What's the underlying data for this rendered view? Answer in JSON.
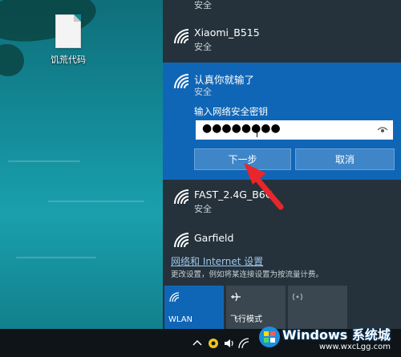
{
  "desktop": {
    "icon_label": "饥荒代码"
  },
  "top_item_status": "安全",
  "networks": [
    {
      "ssid": "Xiaomi_B515",
      "status": "安全"
    },
    {
      "ssid": "FAST_2.4G_B6",
      "ssid_suffix": "C",
      "status": "安全"
    },
    {
      "ssid": "Garfield"
    }
  ],
  "active": {
    "ssid": "认真你就输了",
    "status": "安全",
    "prompt": "输入网络安全密钥",
    "password_mask": "●●●●●●●●",
    "next_button": "下一步",
    "cancel_button": "取消"
  },
  "settings": {
    "link": "网络和 Internet 设置",
    "description": "更改设置，例如将某连接设置为按流量计费。"
  },
  "tiles": [
    {
      "label": "WLAN",
      "active": true
    },
    {
      "label": "飞行模式",
      "active": false
    },
    {
      "label": "",
      "active": false
    }
  ],
  "watermark": {
    "title": "Windows 系统城",
    "url": "www.wxcLgg.com"
  },
  "colors": {
    "accent": "#1066b6",
    "flyout": "#25323b",
    "button": "#3f86c8",
    "arrow": "#e8262b"
  }
}
